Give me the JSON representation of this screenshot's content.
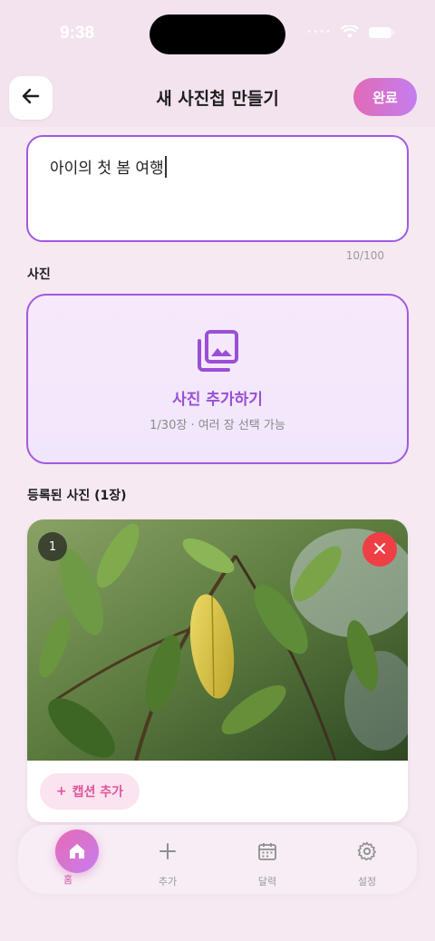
{
  "status": {
    "time": "9:38"
  },
  "header": {
    "title": "새 사진첩 만들기",
    "done_label": "완료"
  },
  "title_field": {
    "value": "아이의 첫 봄 여행",
    "count": "10/100"
  },
  "photos_section": {
    "label": "사진",
    "add_label": "사진 추가하기",
    "add_hint": "1/30장 · 여러 장 선택 가능"
  },
  "registered": {
    "label": "등록된 사진 (1장)",
    "items": [
      {
        "index": "1",
        "caption_button": "캡션 추가",
        "caption_icon": "+"
      }
    ]
  },
  "bottom_nav": {
    "items": [
      {
        "label": "홈",
        "icon": "home-icon",
        "active": true
      },
      {
        "label": "추가",
        "icon": "plus-icon"
      },
      {
        "label": "달력",
        "icon": "calendar-icon"
      },
      {
        "label": "설정",
        "icon": "gear-icon"
      }
    ]
  },
  "colors": {
    "accent": "#a259e0",
    "pink": "#e26ab6",
    "danger": "#ee3f45"
  }
}
